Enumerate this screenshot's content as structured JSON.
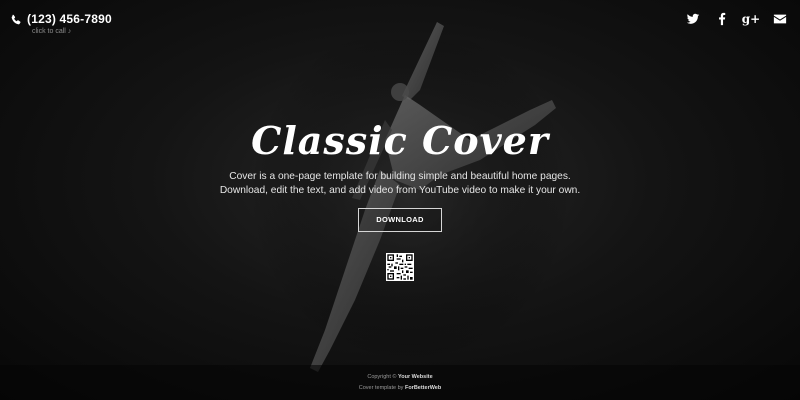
{
  "header": {
    "phone_number": "(123) 456-7890",
    "phone_sub": "click to call",
    "social": [
      {
        "icon": "twitter-icon"
      },
      {
        "icon": "facebook-icon"
      },
      {
        "icon": "google-plus-icon",
        "glyph": "g+"
      },
      {
        "icon": "envelope-icon"
      }
    ]
  },
  "hero": {
    "title": "Classic Cover",
    "description_line1": "Cover is a one-page template for building simple and beautiful home pages.",
    "description_line2": "Download, edit the text, and add video from YouTube video to make it your own.",
    "download_label": "DOWNLOAD"
  },
  "footer": {
    "copyright_prefix": "Copyright ©",
    "copyright_link": "Your Website",
    "template_prefix": "Cover template by",
    "template_link": "ForBetterWeb"
  },
  "colors": {
    "background": "#0b0b0b",
    "text": "#ffffff",
    "muted": "#9a9a9a"
  }
}
